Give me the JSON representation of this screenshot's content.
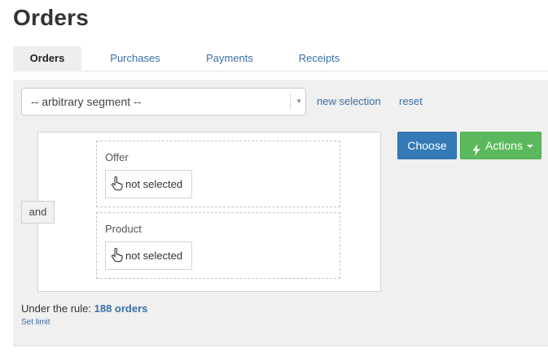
{
  "page": {
    "title": "Orders"
  },
  "tabs": [
    {
      "label": "Orders",
      "active": true
    },
    {
      "label": "Purchases",
      "active": false
    },
    {
      "label": "Payments",
      "active": false
    },
    {
      "label": "Receipts",
      "active": false
    }
  ],
  "segment": {
    "selected": "-- arbitrary segment --",
    "new_selection_label": "new selection",
    "reset_label": "reset"
  },
  "rule": {
    "operator": "and",
    "conditions": [
      {
        "label": "Offer",
        "value": "not selected",
        "icon": "hand-pointer-icon"
      },
      {
        "label": "Product",
        "value": "not selected",
        "icon": "hand-pointer-icon"
      }
    ]
  },
  "actions": {
    "choose_label": "Choose",
    "actions_label": "Actions",
    "actions_icon": "bolt-icon"
  },
  "summary": {
    "prefix": "Under the rule:",
    "count": "188 orders",
    "set_limit_label": "Set limit"
  },
  "colors": {
    "primary": "#337ab7",
    "success": "#5cb85c",
    "link": "#3a6ea5",
    "panel_bg": "#f0f0f0"
  }
}
